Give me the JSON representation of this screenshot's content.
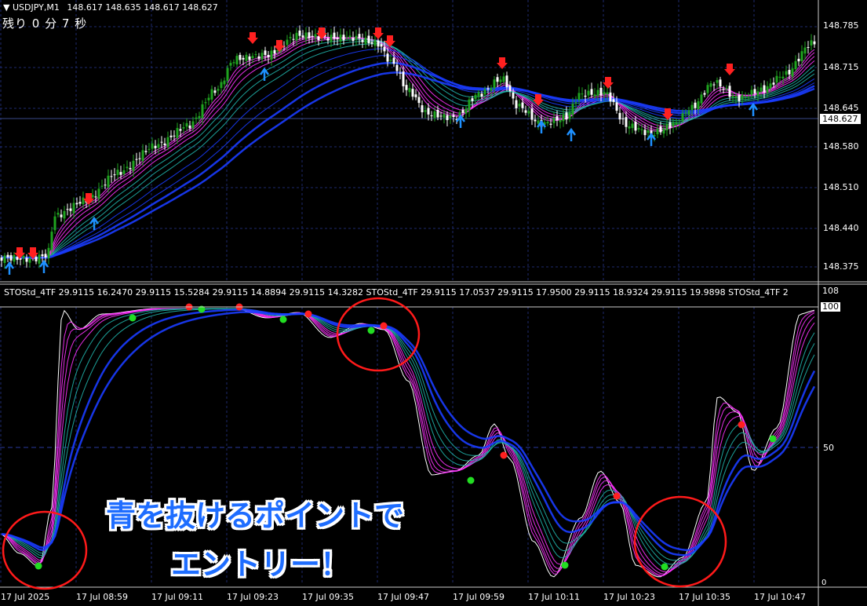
{
  "header": {
    "symbol_label": "USDJPY,M1",
    "ohlc": "148.617 148.635 148.617 148.627",
    "timer": "残り 0 分 7 秒"
  },
  "price_axis": {
    "ticks": [
      "148.785",
      "148.715",
      "148.645",
      "148.580",
      "148.510",
      "148.440",
      "148.375"
    ],
    "current_price": "148.627"
  },
  "indicator": {
    "header": "STOStd_4TF 29.9115 16.2470 29.9115 15.5284 29.9115 14.8894 29.9115 14.3282  STOStd_4TF 29.9115 17.0537 29.9115 17.9500 29.9115 18.9324 29.9115 19.9898  STOStd_4TF 2",
    "axis_ticks": [
      "108",
      "100",
      "50",
      "0"
    ],
    "max_label": "100",
    "level_50": "50",
    "zero_label": "0"
  },
  "time_axis": {
    "labels": [
      "17 Jul 2025",
      "17 Jul 08:59",
      "17 Jul 09:11",
      "17 Jul 09:23",
      "17 Jul 09:35",
      "17 Jul 09:47",
      "17 Jul 09:59",
      "17 Jul 10:11",
      "17 Jul 10:23",
      "17 Jul 10:35",
      "17 Jul 10:47"
    ]
  },
  "annotation": {
    "line1": "青を抜けるポイントで",
    "line2": "エントリー！"
  },
  "colors": {
    "background": "#000000",
    "grid": "#1e2a6e",
    "bull_candle": "#1fa31f",
    "bear_candle": "#ffffff",
    "ribbon_slow": "#1a3cff",
    "ribbon_mid": "#20b2aa",
    "ribbon_fast": "#ff33ff",
    "signal_up": "#1e90ff",
    "signal_down": "#ff2020",
    "circle": "#ff1a1a",
    "annotation_text": "#1e6dff"
  }
}
